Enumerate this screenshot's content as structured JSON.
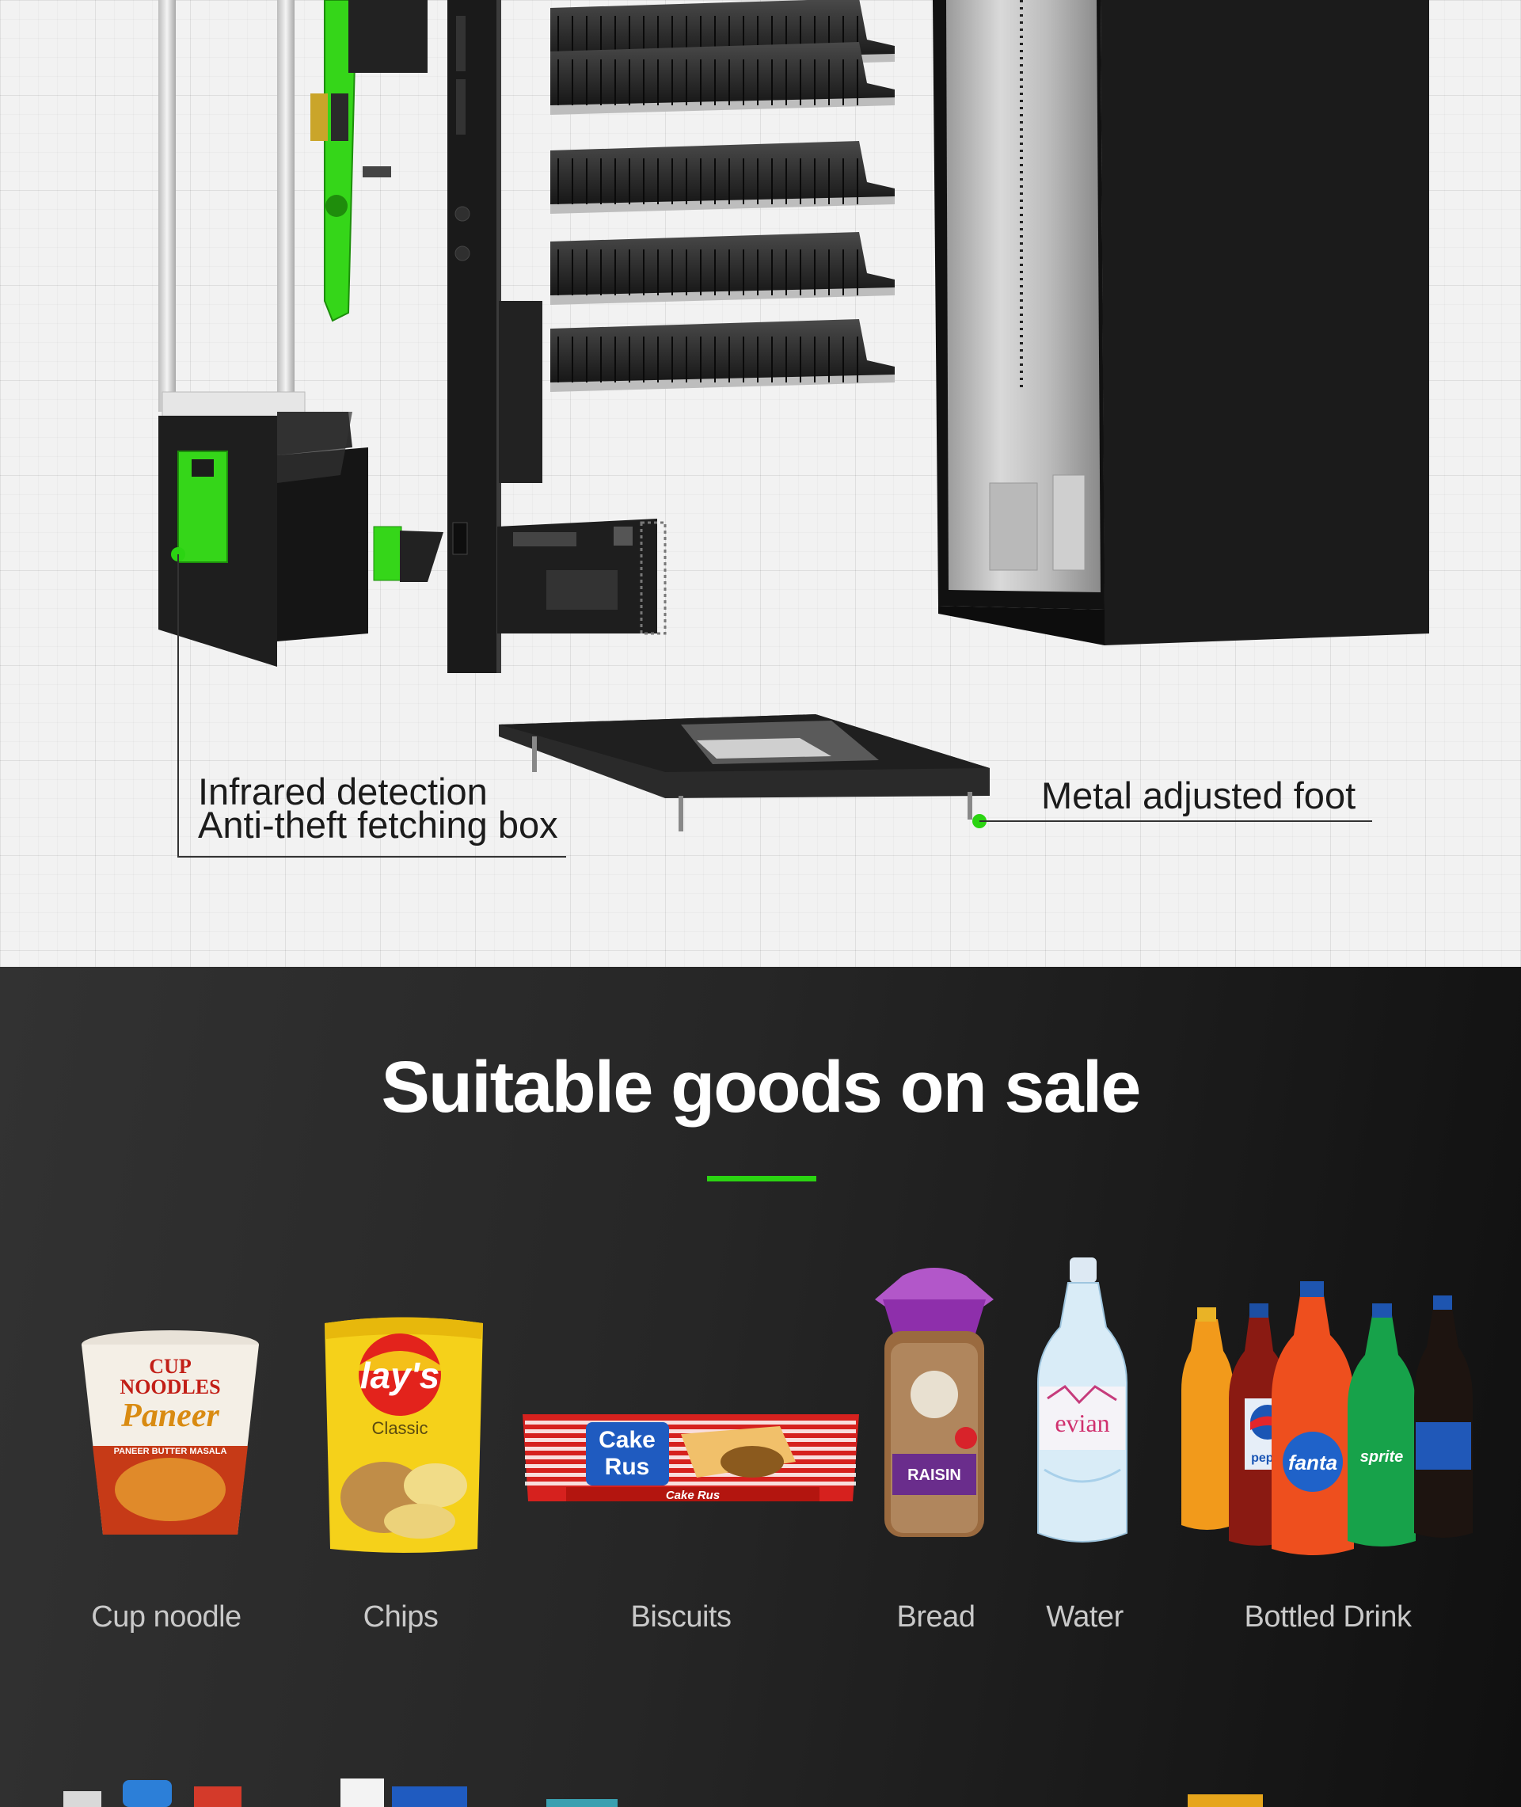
{
  "diagram": {
    "callouts": {
      "fetching_box_line1": "Infrared detection",
      "fetching_box_line2": "Anti-theft fetching box",
      "foot": "Metal adjusted foot"
    },
    "accent_color": "#2bd412"
  },
  "goods_section": {
    "title": "Suitable goods on sale",
    "items": [
      {
        "label": "Cup noodle",
        "icon": "cup-noodle-image",
        "brand_text": [
          "CUP",
          "NOODLES",
          "Paneer",
          "PANEER BUTTER MASALA"
        ]
      },
      {
        "label": "Chips",
        "icon": "chips-bag-image",
        "brand_text": [
          "lay's",
          "Classic"
        ]
      },
      {
        "label": "Biscuits",
        "icon": "biscuit-pack-image",
        "brand_text": [
          "Cake",
          "Rus",
          "Cake Rus"
        ]
      },
      {
        "label": "Bread",
        "icon": "bread-loaf-image",
        "brand_text": [
          "RAISIN"
        ]
      },
      {
        "label": "Water",
        "icon": "water-bottle-image",
        "brand_text": [
          "evian"
        ]
      },
      {
        "label": "Bottled Drink",
        "icon": "soda-bottles-image",
        "brand_text": [
          "pepsi",
          "fanta",
          "sprite"
        ]
      }
    ]
  }
}
